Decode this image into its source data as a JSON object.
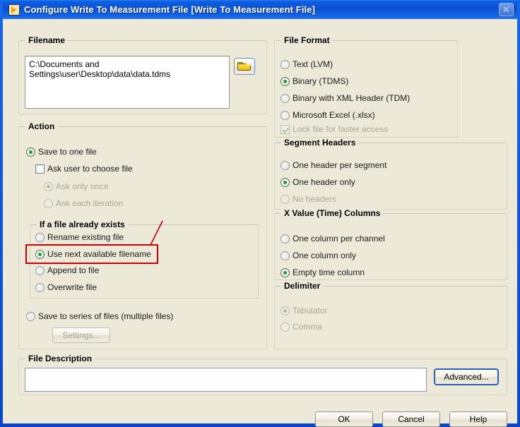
{
  "window": {
    "title": "Configure Write To Measurement File [Write To Measurement File]",
    "app_icon": "labview-icon",
    "close_icon": "close-icon",
    "accent_color": "#0a46c8",
    "client_color": "#ece9d8",
    "annotation_color": "#cc0000"
  },
  "filename": {
    "legend": "Filename",
    "value": "C:\\Documents and Settings\\user\\Desktop\\data\\data.tdms",
    "browse_icon": "folder-open-icon"
  },
  "action": {
    "legend": "Action",
    "save_one_file": {
      "label": "Save to one file",
      "selected": true,
      "enabled": true
    },
    "ask_user": {
      "label": "Ask user to choose file",
      "checked": false,
      "enabled": true
    },
    "ask_once": {
      "label": "Ask only once",
      "selected": true,
      "enabled": false
    },
    "ask_each": {
      "label": "Ask each iteration",
      "selected": false,
      "enabled": false
    },
    "exists": {
      "legend": "If a file already exists",
      "options": [
        {
          "label": "Rename existing file",
          "selected": false
        },
        {
          "label": "Use next available filename",
          "selected": true
        },
        {
          "label": "Append to file",
          "selected": false
        },
        {
          "label": "Overwrite file",
          "selected": false
        }
      ]
    },
    "save_series": {
      "label": "Save to series of files (multiple files)",
      "selected": false,
      "enabled": true
    },
    "settings_button": {
      "label": "Settings...",
      "enabled": false
    }
  },
  "file_format": {
    "legend": "File Format",
    "options": [
      {
        "label": "Text (LVM)",
        "selected": false,
        "enabled": true
      },
      {
        "label": "Binary (TDMS)",
        "selected": true,
        "enabled": true
      },
      {
        "label": "Binary with XML Header (TDM)",
        "selected": false,
        "enabled": true
      },
      {
        "label": "Microsoft Excel (.xlsx)",
        "selected": false,
        "enabled": true
      }
    ],
    "lock_file": {
      "label": "Lock file for faster access",
      "checked": true,
      "enabled": false
    }
  },
  "segment_headers": {
    "legend": "Segment Headers",
    "options": [
      {
        "label": "One header per segment",
        "selected": false,
        "enabled": true
      },
      {
        "label": "One header only",
        "selected": true,
        "enabled": true
      },
      {
        "label": "No headers",
        "selected": false,
        "enabled": false
      }
    ]
  },
  "x_value_columns": {
    "legend": "X Value (Time) Columns",
    "options": [
      {
        "label": "One column per channel",
        "selected": false,
        "enabled": true
      },
      {
        "label": "One column only",
        "selected": false,
        "enabled": true
      },
      {
        "label": "Empty time column",
        "selected": true,
        "enabled": true
      }
    ]
  },
  "delimiter": {
    "legend": "Delimiter",
    "options": [
      {
        "label": "Tabulator",
        "selected": true,
        "enabled": false
      },
      {
        "label": "Comma",
        "selected": false,
        "enabled": false
      }
    ]
  },
  "file_description": {
    "legend": "File Description",
    "value": "",
    "advanced_button": "Advanced..."
  },
  "footer": {
    "ok": "OK",
    "cancel": "Cancel",
    "help": "Help"
  }
}
